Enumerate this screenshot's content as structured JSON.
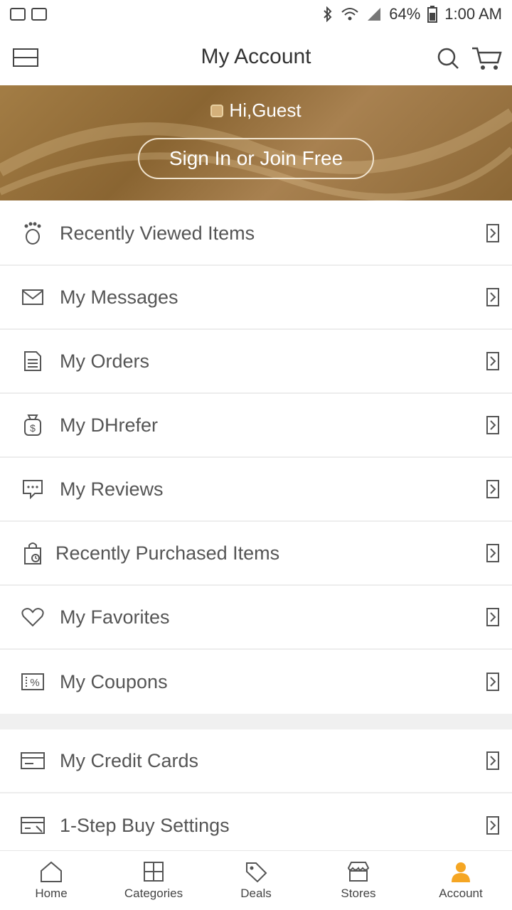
{
  "status_bar": {
    "battery": "64%",
    "time": "1:00 AM"
  },
  "header": {
    "title": "My Account"
  },
  "banner": {
    "greeting": "Hi,Guest",
    "signin_label": "Sign In or Join Free"
  },
  "menu_items": [
    {
      "label": "Recently Viewed Items",
      "icon": "footprint-icon"
    },
    {
      "label": "My Messages",
      "icon": "envelope-icon"
    },
    {
      "label": "My Orders",
      "icon": "document-icon"
    },
    {
      "label": "My DHrefer",
      "icon": "money-bag-icon"
    },
    {
      "label": "My Reviews",
      "icon": "chat-bubble-icon"
    },
    {
      "label": "Recently Purchased Items",
      "icon": "shopping-bag-clock-icon"
    },
    {
      "label": "My Favorites",
      "icon": "heart-icon"
    },
    {
      "label": "My Coupons",
      "icon": "coupon-icon"
    }
  ],
  "menu_items_2": [
    {
      "label": "My Credit Cards",
      "icon": "credit-card-icon"
    },
    {
      "label": "1-Step Buy Settings",
      "icon": "card-settings-icon"
    }
  ],
  "bottom_nav": [
    {
      "label": "Home",
      "icon": "home-icon"
    },
    {
      "label": "Categories",
      "icon": "grid-icon"
    },
    {
      "label": "Deals",
      "icon": "tag-icon"
    },
    {
      "label": "Stores",
      "icon": "store-icon"
    },
    {
      "label": "Account",
      "icon": "user-icon"
    }
  ],
  "colors": {
    "accent": "#f5a623",
    "banner": "#9a7440",
    "icon": "#555555"
  }
}
